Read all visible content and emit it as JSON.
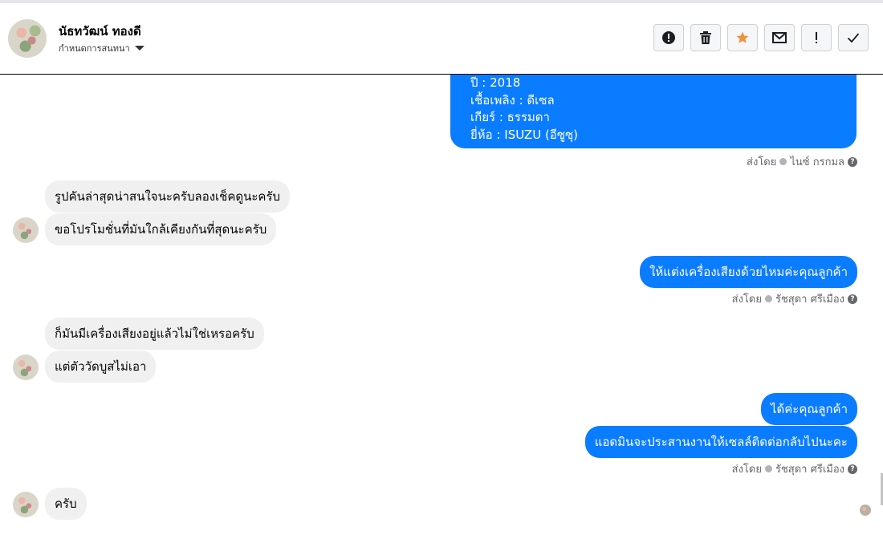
{
  "header": {
    "contact_name": "นัธทวัฒน์ ทองดี",
    "subtitle": "กำหนดการสนทนา",
    "toolbar": [
      {
        "icon": "alert-circle-icon",
        "name": "report-button"
      },
      {
        "icon": "trash-icon",
        "name": "delete-button"
      },
      {
        "icon": "star-icon",
        "name": "star-button",
        "color": "#f0913b"
      },
      {
        "icon": "envelope-icon",
        "name": "mark-unread-button"
      },
      {
        "icon": "exclamation-icon",
        "name": "flag-button"
      },
      {
        "icon": "check-icon",
        "name": "done-button"
      }
    ]
  },
  "messages": {
    "m1": {
      "lines": [
        "ปี : 2018",
        "เชื้อเพลิง : ดีเซล",
        "เกียร์ : ธรรมดา",
        "ยี่ห้อ : ISUZU (อีซูซุ)"
      ]
    },
    "sent1": {
      "prefix": "ส่งโดย",
      "sender": "ไนซ์ กรกมล"
    },
    "m2": {
      "text": "รูปคันล่าสุดน่าสนใจนะครับลองเช็คดูนะครับ"
    },
    "m3": {
      "text": "ขอโปรโมชั่นที่มันใกล้เคียงกันที่สุดนะครับ"
    },
    "m4": {
      "text": "ให้แต่งเครื่องเสียงด้วยไหมค่ะคุณลูกค้า"
    },
    "sent2": {
      "prefix": "ส่งโดย",
      "sender": "รัชสุดา ศรีเมือง"
    },
    "m5": {
      "text": "ก็มันมีเครื่องเสียงอยู่แล้วไม่ใช่เหรอครับ"
    },
    "m6": {
      "text": "แต่ตัววัดบูสไม่เอา"
    },
    "m7": {
      "text": "ได้ค่ะคุณลูกค้า"
    },
    "m8": {
      "text": "แอดมินจะประสานงานให้เซลล์ติดต่อกลับไปนะคะ"
    },
    "sent3": {
      "prefix": "ส่งโดย",
      "sender": "รัชสุดา ศรีเมือง"
    },
    "m9": {
      "text": "ครับ"
    }
  },
  "colors": {
    "outgoing": "#0a7cff",
    "incoming": "#f0f0f0",
    "star": "#f0913b"
  }
}
